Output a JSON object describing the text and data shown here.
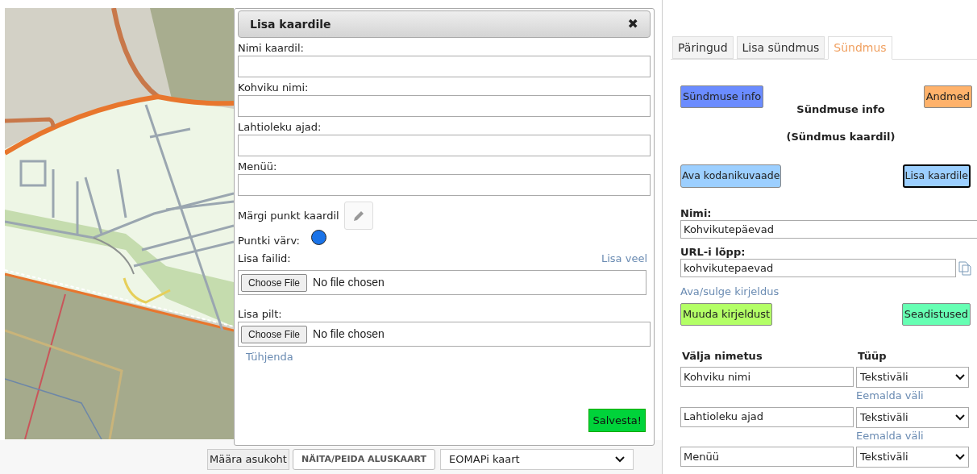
{
  "dialog": {
    "title": "Lisa kaardile",
    "close": "✖",
    "fields": [
      {
        "label": "Nimi kaardil:"
      },
      {
        "label": "Kohviku nimi:"
      },
      {
        "label": "Lahtioleku ajad:"
      },
      {
        "label": "Menüü:"
      }
    ],
    "mark_point": {
      "label": "Märgi punkt kaardil"
    },
    "point_color": {
      "label": "Puntki värv:",
      "color": "#1a73e8"
    },
    "files": {
      "label": "Lisa failid:",
      "add_more": "Lisa veel",
      "button": "Choose File",
      "status": "No file chosen"
    },
    "image": {
      "label": "Lisa pilt:",
      "button": "Choose File",
      "status": "No file chosen",
      "clear": "Tühjenda"
    },
    "save": "Salvesta!"
  },
  "bottom_bar": {
    "locate": "Määra asukoht",
    "toggle": "NÄITA/PEIDA ALUSKAART",
    "basemap": "EOMAPi kaart"
  },
  "panel": {
    "tabs": [
      {
        "label": "Päringud",
        "selected": false
      },
      {
        "label": "Lisa sündmus",
        "selected": false
      },
      {
        "label": "Sündmus",
        "selected": true
      }
    ],
    "top_buttons": [
      {
        "label": "Sündmuse info",
        "color": "#6b8cff",
        "focused": false
      },
      {
        "label": "Andmed",
        "color": "#ffb26b",
        "focused": false
      }
    ],
    "heading": "Sündmuse info",
    "subheading": "(Sündmus kaardil)",
    "action_buttons": [
      {
        "label": "Ava kodanikuvaade",
        "color": "#9ccfff",
        "focused": false
      },
      {
        "label": "Lisa kaardile",
        "color": "#9ccfff",
        "focused": true
      }
    ],
    "name": {
      "label": "Nimi:",
      "value": "Kohvikutepäevad"
    },
    "url": {
      "label": "URL-i lõpp:",
      "value": "kohvikutepaevad"
    },
    "toggle_description": "Ava/sulge kirjeldus",
    "edit_buttons": [
      {
        "label": "Muuda kirjeldust",
        "color": "#b3ff66"
      },
      {
        "label": "Seadistused",
        "color": "#66ffb3"
      }
    ],
    "columns": [
      "Välja nimetus",
      "Tüüp"
    ],
    "rows": [
      {
        "name": "Kohviku nimi",
        "type": "Tekstiväli",
        "remove": "Eemalda väli"
      },
      {
        "name": "Lahtioleku ajad",
        "type": "Tekstiväli",
        "remove": "Eemalda väli"
      },
      {
        "name": "Menüü",
        "type": "Tekstiväli"
      }
    ]
  }
}
